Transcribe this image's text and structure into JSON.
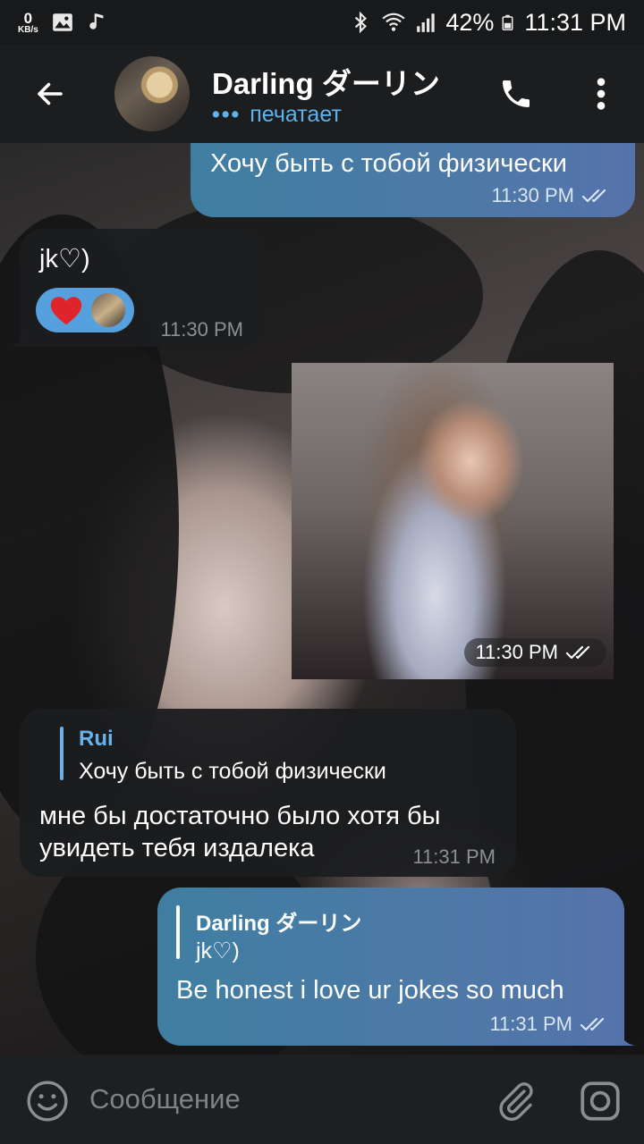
{
  "status_bar": {
    "net_speed_value": "0",
    "net_speed_unit": "KB/s",
    "battery": "42%",
    "time": "11:31 PM",
    "icons": [
      "image-icon",
      "music-note-icon",
      "bluetooth-icon",
      "wifi-icon",
      "signal-icon",
      "battery-icon"
    ]
  },
  "header": {
    "contact_name": "Darling ダーリン",
    "status_dots": "•••",
    "status": "печатает",
    "icons": [
      "back-arrow-icon",
      "phone-icon",
      "more-vert-icon"
    ]
  },
  "messages": [
    {
      "id": "m1",
      "direction": "outgoing",
      "text": "Хочу быть с тобой физически",
      "time": "11:30 PM",
      "read": true
    },
    {
      "id": "m2",
      "direction": "incoming",
      "text": "jk♡)",
      "reaction": "❤️",
      "time": "11:30 PM"
    },
    {
      "id": "m3",
      "direction": "outgoing",
      "type": "photo",
      "time": "11:30 PM",
      "read": true
    },
    {
      "id": "m4",
      "direction": "incoming",
      "reply_to": {
        "name": "Rui",
        "text": "Хочу быть с тобой физически"
      },
      "text_line1": "мне бы достаточно было хотя бы",
      "text_line2": "увидеть тебя издалека",
      "time": "11:31 PM"
    },
    {
      "id": "m5",
      "direction": "outgoing",
      "reply_to": {
        "name": "Darling ダーリン",
        "text": "jk♡)"
      },
      "text": "Be honest i love ur jokes so much",
      "time": "11:31 PM",
      "read": true
    }
  ],
  "composer": {
    "placeholder": "Сообщение",
    "icons": [
      "emoji-icon",
      "attach-icon",
      "camera-icon"
    ]
  },
  "colors": {
    "outgoing_bubble": "#4d79a6",
    "incoming_bubble": "#1c1d1f",
    "accent": "#67b2ea",
    "reaction_pill": "#57a0de"
  }
}
